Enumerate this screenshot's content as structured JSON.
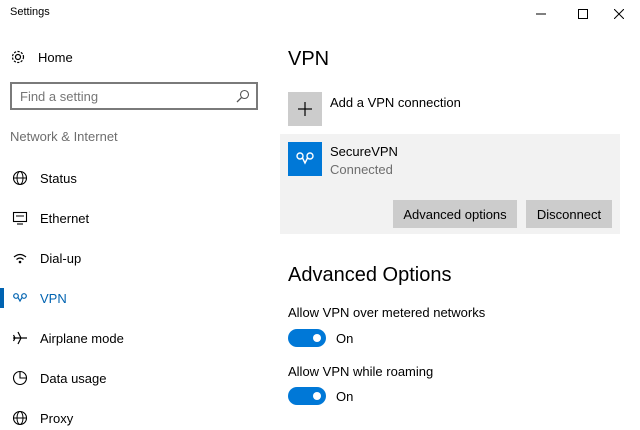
{
  "window": {
    "title": "Settings"
  },
  "sidebar": {
    "home_label": "Home",
    "search_placeholder": "Find a setting",
    "section_title": "Network & Internet",
    "items": [
      {
        "label": "Status",
        "icon": "globe-icon",
        "active": false
      },
      {
        "label": "Ethernet",
        "icon": "ethernet-icon",
        "active": false
      },
      {
        "label": "Dial-up",
        "icon": "dialup-icon",
        "active": false
      },
      {
        "label": "VPN",
        "icon": "vpn-icon",
        "active": true
      },
      {
        "label": "Airplane mode",
        "icon": "airplane-icon",
        "active": false
      },
      {
        "label": "Data usage",
        "icon": "data-usage-icon",
        "active": false
      },
      {
        "label": "Proxy",
        "icon": "globe-icon",
        "active": false
      }
    ]
  },
  "main": {
    "title": "VPN",
    "add_label": "Add a VPN connection",
    "connection": {
      "name": "SecureVPN",
      "status": "Connected",
      "advanced_button": "Advanced options",
      "disconnect_button": "Disconnect"
    },
    "advanced": {
      "heading": "Advanced Options",
      "options": [
        {
          "label": "Allow VPN over metered networks",
          "state": "On"
        },
        {
          "label": "Allow VPN while roaming",
          "state": "On"
        }
      ]
    }
  },
  "colors": {
    "accent": "#0078d7",
    "active_text": "#0063b1",
    "card_bg": "#f2f2f2",
    "button_bg": "#cccccc"
  }
}
